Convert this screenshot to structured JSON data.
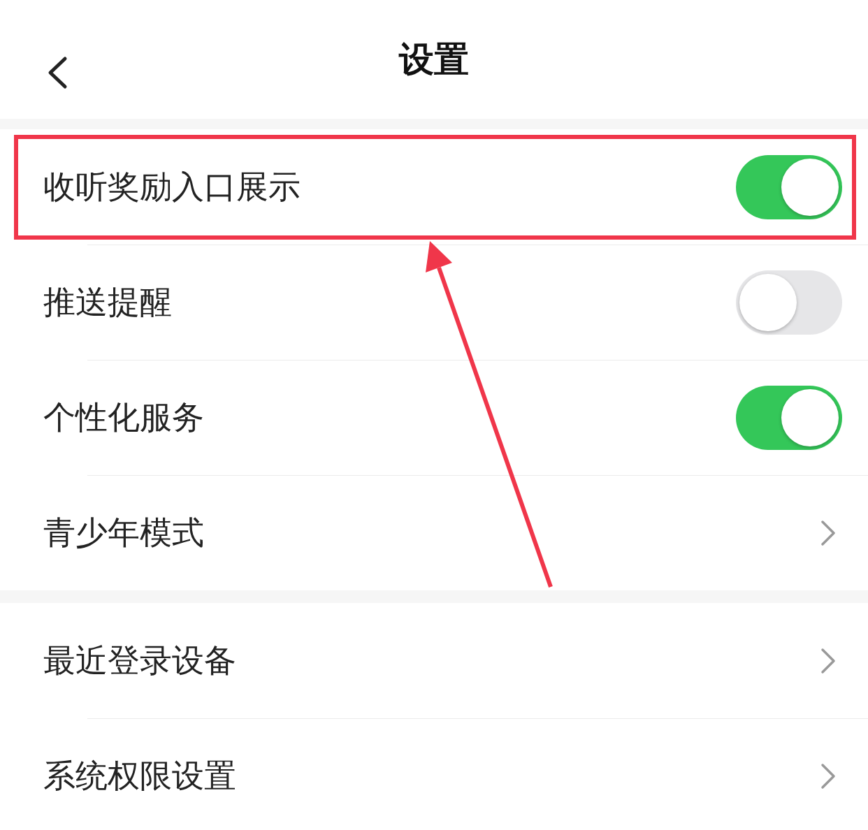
{
  "header": {
    "title": "设置"
  },
  "sections": [
    {
      "rows": [
        {
          "label": "收听奖励入口展示",
          "kind": "toggle",
          "on": true,
          "highlighted": true
        },
        {
          "label": "推送提醒",
          "kind": "toggle",
          "on": false,
          "highlighted": false
        },
        {
          "label": "个性化服务",
          "kind": "toggle",
          "on": true,
          "highlighted": false
        },
        {
          "label": "青少年模式",
          "kind": "link",
          "highlighted": false
        }
      ]
    },
    {
      "rows": [
        {
          "label": "最近登录设备",
          "kind": "link",
          "highlighted": false
        },
        {
          "label": "系统权限设置",
          "kind": "link",
          "highlighted": false
        }
      ]
    }
  ]
}
